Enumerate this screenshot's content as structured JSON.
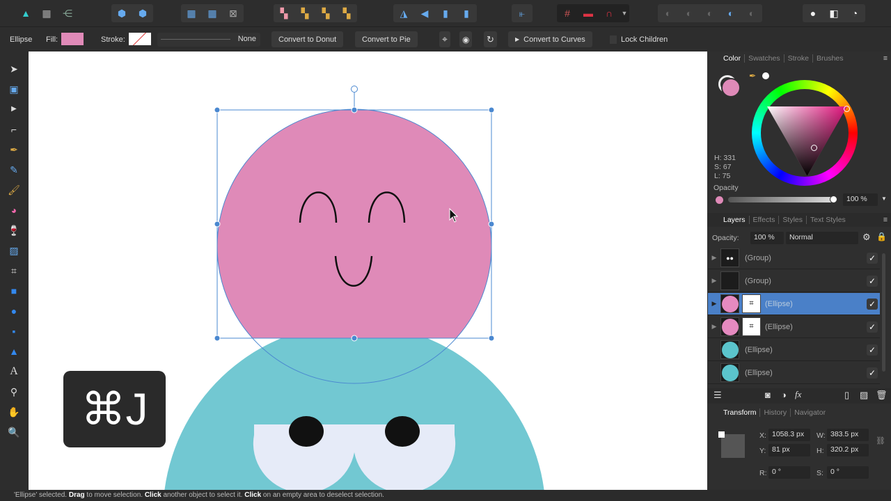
{
  "context": {
    "object": "Ellipse",
    "fill_label": "Fill:",
    "stroke_label": "Stroke:",
    "stroke_value": "None",
    "convert_donut": "Convert to Donut",
    "convert_pie": "Convert to Pie",
    "convert_curves": "Convert to Curves",
    "lock_children": "Lock Children",
    "fill_color": "#e08ab8"
  },
  "color_panel": {
    "tabs": [
      "Color",
      "Swatches",
      "Stroke",
      "Brushes"
    ],
    "h": "H: 331",
    "s": "S: 67",
    "l": "L: 75",
    "opacity_label": "Opacity",
    "opacity_value": "100 %"
  },
  "layers_panel": {
    "tabs": [
      "Layers",
      "Effects",
      "Styles",
      "Text Styles"
    ],
    "opacity_label": "Opacity:",
    "opacity_value": "100 %",
    "blend": "Normal",
    "items": [
      {
        "name": "(Group)"
      },
      {
        "name": "(Group)"
      },
      {
        "name": "(Ellipse)"
      },
      {
        "name": "(Ellipse)"
      },
      {
        "name": "(Ellipse)"
      },
      {
        "name": "(Ellipse)"
      }
    ]
  },
  "transform_panel": {
    "tabs": [
      "Transform",
      "History",
      "Navigator"
    ],
    "x_label": "X:",
    "x": "1058.3 px",
    "y_label": "Y:",
    "y": "81 px",
    "w_label": "W:",
    "w": "383.5 px",
    "h_label": "H:",
    "h": "320.2 px",
    "r_label": "R:",
    "r": "0 °",
    "s_label": "S:",
    "s": "0 °"
  },
  "overlay": {
    "shortcut": "⌘J"
  },
  "status": {
    "p1": "'Ellipse' selected. ",
    "b1": "Drag",
    "p2": " to move selection. ",
    "b2": "Click",
    "p3": " another object to select it. ",
    "b3": "Click",
    "p4": " on an empty area to deselect selection."
  }
}
